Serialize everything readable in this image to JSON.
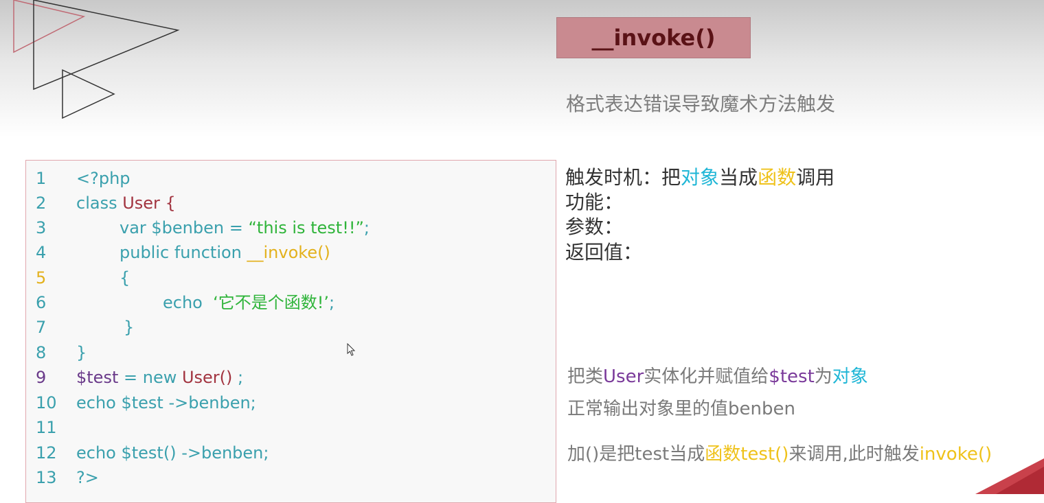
{
  "title": "__invoke()",
  "subtitle": "格式表达错误导致魔术方法触发",
  "code_lines": [
    {
      "num": "1",
      "parts": [
        "<?php"
      ]
    },
    {
      "num": "2",
      "parts": [
        "class ",
        "User {"
      ]
    },
    {
      "num": "3",
      "parts": [
        "var $benben = ",
        "“this is test!!”",
        ";"
      ]
    },
    {
      "num": "4",
      "parts": [
        "public function ",
        "__invoke()"
      ]
    },
    {
      "num": "5",
      "parts": [
        "{"
      ]
    },
    {
      "num": "6",
      "parts": [
        "echo  ",
        "‘它不是个函数!’",
        ";"
      ]
    },
    {
      "num": "7",
      "parts": [
        "}"
      ]
    },
    {
      "num": "8",
      "parts": [
        "}"
      ]
    },
    {
      "num": "9",
      "parts": [
        "$test",
        " = new ",
        "User()",
        " ;"
      ]
    },
    {
      "num": "10",
      "parts": [
        "echo $test ->benben;"
      ]
    },
    {
      "num": "11",
      "parts": [
        ""
      ]
    },
    {
      "num": "12",
      "parts": [
        "echo $test() ->benben;"
      ]
    },
    {
      "num": "13",
      "parts": [
        "?>"
      ]
    }
  ],
  "annotations": {
    "trigger_label": "触发时机：",
    "trigger_parts": [
      "把",
      "对象",
      "当成",
      "函数",
      "调用"
    ],
    "function_label": "功能：",
    "params_label": "参数：",
    "return_label": "返回值："
  },
  "notes": {
    "line1_parts": [
      "把类",
      "User",
      "实体化并赋值给",
      "$test",
      "为",
      "对象"
    ],
    "line2": "正常输出对象里的值benben",
    "line3_parts": [
      "加()是把test当成",
      "函数test()",
      "来调用,此时触发",
      "invoke()"
    ]
  },
  "colors": {
    "accent_title_bg": "#c98a90",
    "code_teal": "#3aa0ad",
    "code_red": "#a23440",
    "code_green": "#2fb43a",
    "code_yellow": "#e3b11c",
    "code_purple": "#6a3a8a",
    "highlight_cyan": "#1fb6d6",
    "highlight_yellow": "#efc21a"
  }
}
